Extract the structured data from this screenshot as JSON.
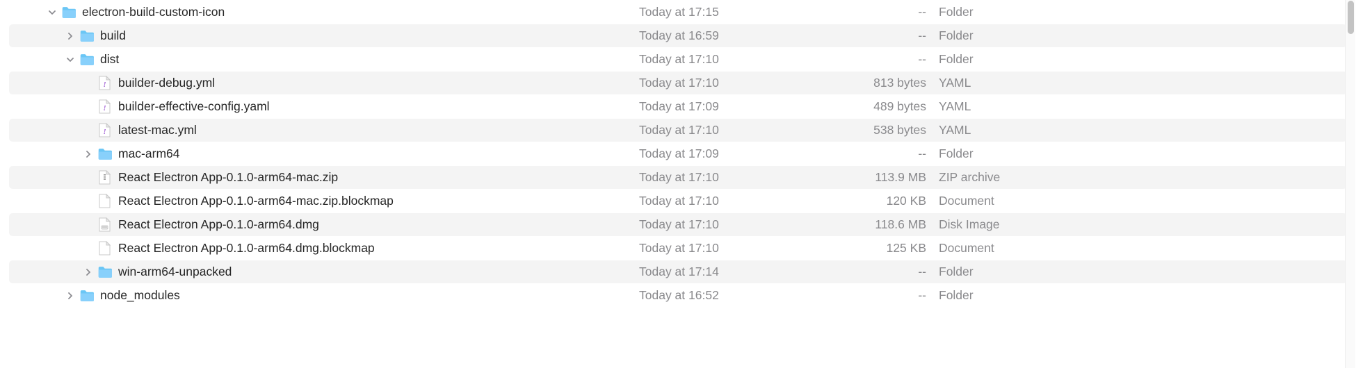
{
  "colors": {
    "folder_light": "#88d0fb",
    "folder_dark": "#59beee",
    "text_muted": "#8a8a8d"
  },
  "rows": [
    {
      "name": "electron-build-custom-icon",
      "date": "Today at 17:15",
      "size": "--",
      "kind": "Folder",
      "indent": 0,
      "disclosure": "down",
      "icon": "folder",
      "alt": false
    },
    {
      "name": "build",
      "date": "Today at 16:59",
      "size": "--",
      "kind": "Folder",
      "indent": 1,
      "disclosure": "right",
      "icon": "folder",
      "alt": true
    },
    {
      "name": "dist",
      "date": "Today at 17:10",
      "size": "--",
      "kind": "Folder",
      "indent": 1,
      "disclosure": "down",
      "icon": "folder",
      "alt": false
    },
    {
      "name": "builder-debug.yml",
      "date": "Today at 17:10",
      "size": "813 bytes",
      "kind": "YAML",
      "indent": 2,
      "disclosure": "none",
      "icon": "yaml",
      "alt": true
    },
    {
      "name": "builder-effective-config.yaml",
      "date": "Today at 17:09",
      "size": "489 bytes",
      "kind": "YAML",
      "indent": 2,
      "disclosure": "none",
      "icon": "yaml",
      "alt": false
    },
    {
      "name": "latest-mac.yml",
      "date": "Today at 17:10",
      "size": "538 bytes",
      "kind": "YAML",
      "indent": 2,
      "disclosure": "none",
      "icon": "yaml",
      "alt": true
    },
    {
      "name": "mac-arm64",
      "date": "Today at 17:09",
      "size": "--",
      "kind": "Folder",
      "indent": 2,
      "disclosure": "right",
      "icon": "folder",
      "alt": false
    },
    {
      "name": "React Electron App-0.1.0-arm64-mac.zip",
      "date": "Today at 17:10",
      "size": "113.9 MB",
      "kind": "ZIP archive",
      "indent": 2,
      "disclosure": "none",
      "icon": "zip",
      "alt": true
    },
    {
      "name": "React Electron App-0.1.0-arm64-mac.zip.blockmap",
      "date": "Today at 17:10",
      "size": "120 KB",
      "kind": "Document",
      "indent": 2,
      "disclosure": "none",
      "icon": "doc",
      "alt": false
    },
    {
      "name": "React Electron App-0.1.0-arm64.dmg",
      "date": "Today at 17:10",
      "size": "118.6 MB",
      "kind": "Disk Image",
      "indent": 2,
      "disclosure": "none",
      "icon": "dmg",
      "alt": true
    },
    {
      "name": "React Electron App-0.1.0-arm64.dmg.blockmap",
      "date": "Today at 17:10",
      "size": "125 KB",
      "kind": "Document",
      "indent": 2,
      "disclosure": "none",
      "icon": "doc",
      "alt": false
    },
    {
      "name": "win-arm64-unpacked",
      "date": "Today at 17:14",
      "size": "--",
      "kind": "Folder",
      "indent": 2,
      "disclosure": "right",
      "icon": "folder",
      "alt": true
    },
    {
      "name": "node_modules",
      "date": "Today at 16:52",
      "size": "--",
      "kind": "Folder",
      "indent": 1,
      "disclosure": "right",
      "icon": "folder",
      "alt": false
    }
  ]
}
